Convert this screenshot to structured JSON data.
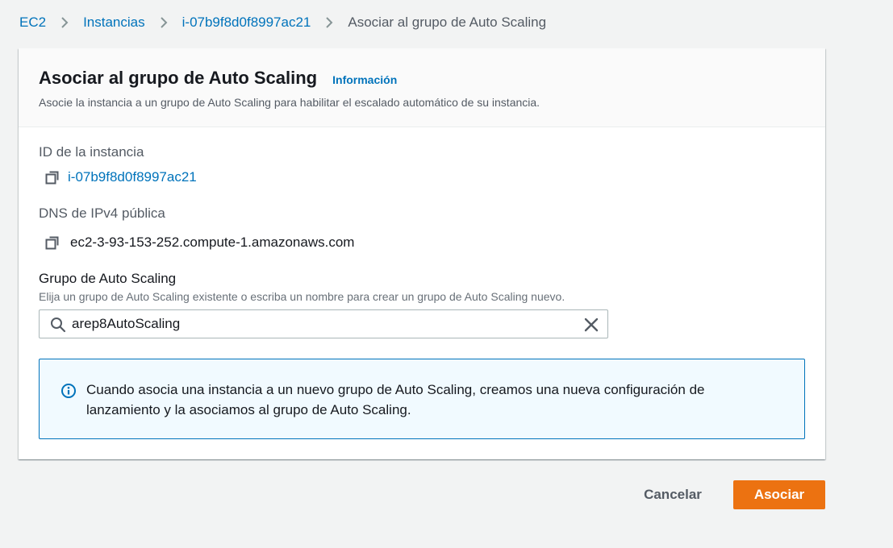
{
  "breadcrumb": {
    "items": [
      {
        "label": "EC2"
      },
      {
        "label": "Instancias"
      },
      {
        "label": "i-07b9f8d0f8997ac21"
      },
      {
        "label": "Asociar al grupo de Auto Scaling"
      }
    ]
  },
  "panel": {
    "title": "Asociar al grupo de Auto Scaling",
    "info_link": "Información",
    "description": "Asocie la instancia a un grupo de Auto Scaling para habilitar el escalado automático de su instancia."
  },
  "instance": {
    "id_label": "ID de la instancia",
    "id_value": "i-07b9f8d0f8997ac21",
    "dns_label": "DNS de IPv4 pública",
    "dns_value": "ec2-3-93-153-252.compute-1.amazonaws.com"
  },
  "asg_field": {
    "label": "Grupo de Auto Scaling",
    "description": "Elija un grupo de Auto Scaling existente o escriba un nombre para crear un grupo de Auto Scaling nuevo.",
    "value": "arep8AutoScaling"
  },
  "alert": {
    "text": "Cuando asocia una instancia a un nuevo grupo de Auto Scaling, creamos una nueva configuración de lanzamiento y la asociamos al grupo de Auto Scaling."
  },
  "actions": {
    "cancel_label": "Cancelar",
    "submit_label": "Asociar"
  },
  "icons": {
    "copy": "copy-icon",
    "search": "search-icon",
    "clear": "close-icon",
    "info": "info-circle-icon",
    "separator": "chevron-right-icon"
  },
  "colors": {
    "link": "#0073bb",
    "primary_button": "#ec7211",
    "alert_background": "#f1faff",
    "alert_border": "#0073bb",
    "page_background": "#f2f3f3"
  }
}
